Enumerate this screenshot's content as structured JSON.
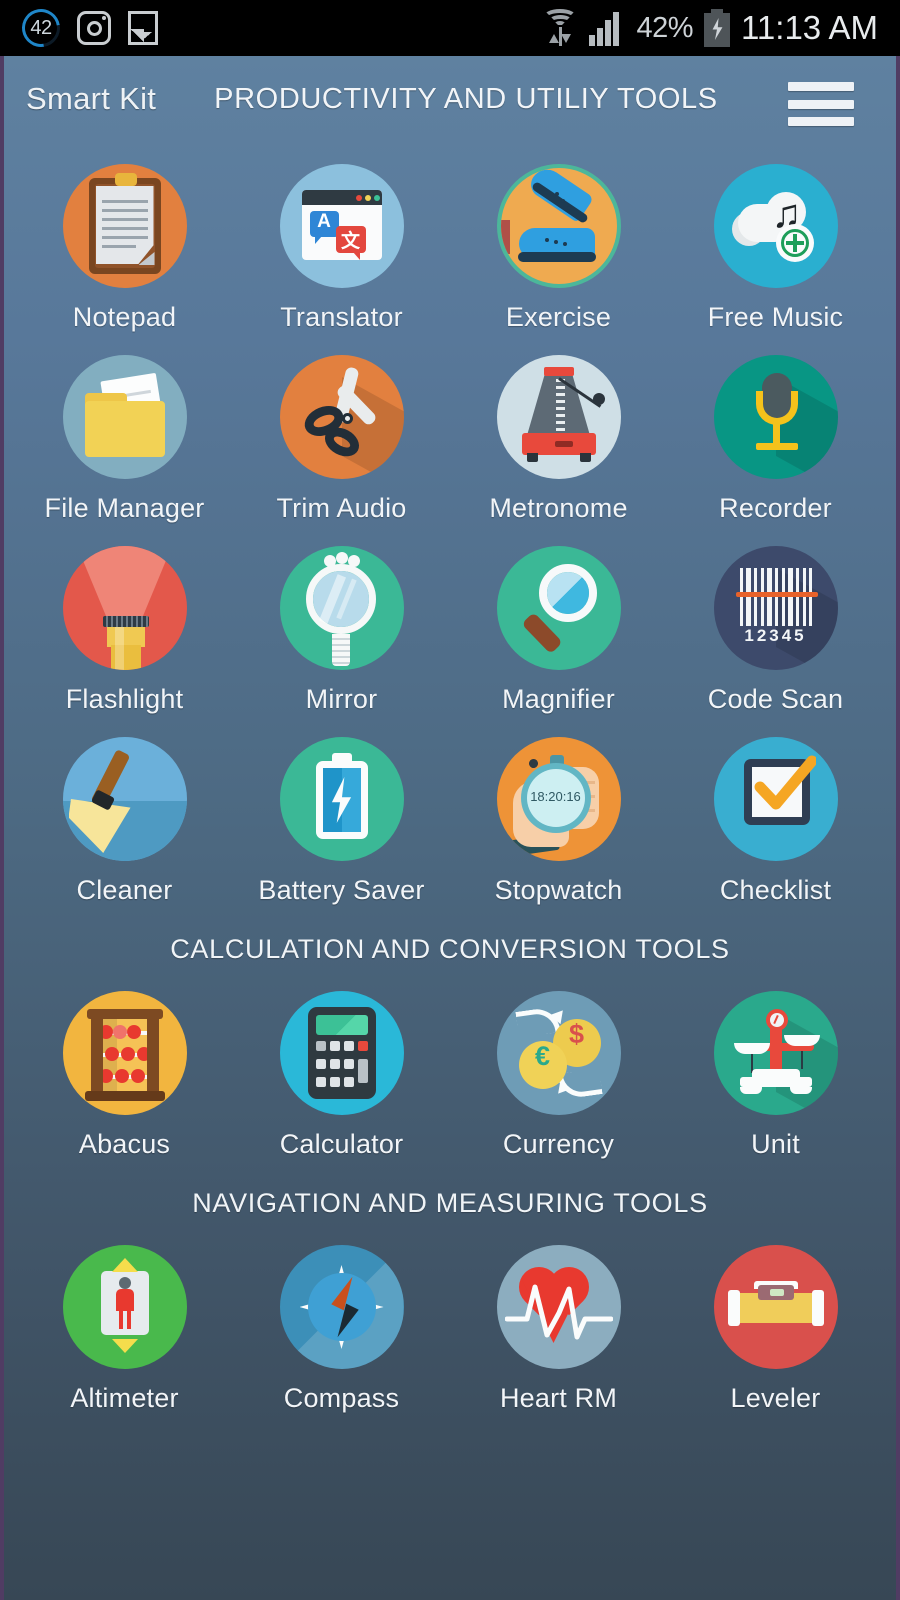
{
  "status_bar": {
    "notification_badge": "42",
    "icons": [
      "notification-count-badge",
      "instagram-camera-icon",
      "gallery-image-icon",
      "wifi-transfer-icon",
      "cellular-signal-icon",
      "battery-charging-icon"
    ],
    "battery_percent": "42%",
    "clock": "11:13 AM"
  },
  "app_bar": {
    "brand": "Smart Kit",
    "screen_title": "PRODUCTIVITY AND UTILIY TOOLS",
    "menu_icon": "hamburger-menu-icon"
  },
  "theme": {
    "bg_top": "#5f81a0",
    "bg_bottom": "#374755",
    "text": "#f2f5f8",
    "statusbar_bg": "#000000",
    "edge": "#503c63"
  },
  "sections": [
    {
      "heading": "",
      "tools": [
        {
          "label": "Notepad",
          "icon": "notepad-icon",
          "color": "#e2803f"
        },
        {
          "label": "Translator",
          "icon": "translator-icon",
          "color": "#8cc0dd"
        },
        {
          "label": "Exercise",
          "icon": "exercise-shoes-icon",
          "color": "#efaa50"
        },
        {
          "label": "Free Music",
          "icon": "free-music-cloud-icon",
          "color": "#2aafd0"
        },
        {
          "label": "File Manager",
          "icon": "file-manager-folder-icon",
          "color": "#82aec0"
        },
        {
          "label": "Trim Audio",
          "icon": "trim-audio-scissors-icon",
          "color": "#e2803f"
        },
        {
          "label": "Metronome",
          "icon": "metronome-icon",
          "color": "#cfdfe6"
        },
        {
          "label": "Recorder",
          "icon": "recorder-microphone-icon",
          "color": "#089684"
        },
        {
          "label": "Flashlight",
          "icon": "flashlight-icon",
          "color": "#e3584b"
        },
        {
          "label": "Mirror",
          "icon": "mirror-icon",
          "color": "#3bb896"
        },
        {
          "label": "Magnifier",
          "icon": "magnifier-icon",
          "color": "#3bb896"
        },
        {
          "label": "Code Scan",
          "icon": "barcode-scan-icon",
          "color": "#3d4a6b"
        },
        {
          "label": "Cleaner",
          "icon": "cleaner-broom-icon",
          "color": "#6bb0da"
        },
        {
          "label": "Battery Saver",
          "icon": "battery-saver-icon",
          "color": "#3bb896"
        },
        {
          "label": "Stopwatch",
          "icon": "stopwatch-hand-icon",
          "color": "#ee9337"
        },
        {
          "label": "Checklist",
          "icon": "checklist-icon",
          "color": "#39aed0"
        }
      ]
    },
    {
      "heading": "CALCULATION AND CONVERSION TOOLS",
      "tools": [
        {
          "label": "Abacus",
          "icon": "abacus-icon",
          "color": "#f2b53f"
        },
        {
          "label": "Calculator",
          "icon": "calculator-icon",
          "color": "#2ab8d8"
        },
        {
          "label": "Currency",
          "icon": "currency-exchange-icon",
          "color": "#6e9cb6"
        },
        {
          "label": "Unit",
          "icon": "unit-balance-scale-icon",
          "color": "#2aa98c"
        }
      ]
    },
    {
      "heading": "NAVIGATION AND MEASURING TOOLS",
      "tools": [
        {
          "label": "Altimeter",
          "icon": "altimeter-elevator-icon",
          "color": "#49b94c"
        },
        {
          "label": "Compass",
          "icon": "compass-icon",
          "color": "#3c8fb8"
        },
        {
          "label": "Heart RM",
          "icon": "heart-rate-monitor-icon",
          "color": "#8cadbf"
        },
        {
          "label": "Leveler",
          "icon": "spirit-level-icon",
          "color": "#d9504c"
        }
      ]
    }
  ],
  "icon_text": {
    "translator_source": "A",
    "translator_target": "文",
    "barcode_digits": "12345",
    "stopwatch_time": "18:20:16",
    "currency_euro": "€",
    "currency_dollar": "$"
  }
}
